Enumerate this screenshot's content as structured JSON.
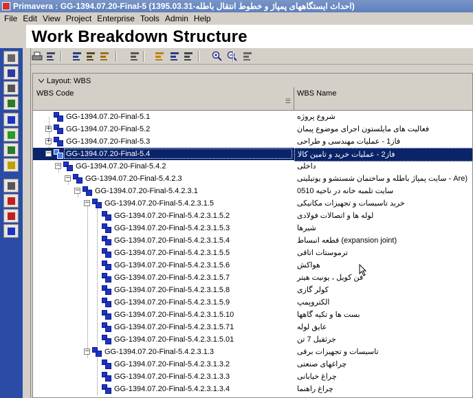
{
  "window": {
    "title": "Primavera : GG-1394.07.20-Final-5 (1395.03.31-احداث ایستگاههای پمپاژ و خطوط انتقال باطله)"
  },
  "menu": [
    "File",
    "Edit",
    "View",
    "Project",
    "Enterprise",
    "Tools",
    "Admin",
    "Help"
  ],
  "page": {
    "title": "Work Breakdown Structure"
  },
  "layout": {
    "label": "Layout: WBS"
  },
  "columns": {
    "code": "WBS Code",
    "name": "WBS Name"
  },
  "colors": {
    "selection": "#0a246a",
    "node": "#1c34c4",
    "left_toolbar": "#2a4ca6"
  },
  "toolbar_icons": [
    "print-icon",
    "print-preview-icon",
    "link-icon",
    "layout-icon",
    "group-icon",
    "filter-icon",
    "columns-icon",
    "bars-icon",
    "table-icon",
    "zoom-in-icon",
    "zoom-out-icon",
    "settings-icon"
  ],
  "left_toolbar_icons": [
    "projects-icon",
    "resources-icon",
    "reports-icon",
    "tracking-icon",
    "wbs-icon",
    "activities-icon",
    "assignments-icon",
    "documents-icon",
    "expenses-icon",
    "issues-icon",
    "risks-icon",
    "next-icon"
  ],
  "rows": [
    {
      "code": "GG-1394.07.20-Final-5.1",
      "name": "شروع پروژه",
      "level": 1,
      "expander": "",
      "selected": false
    },
    {
      "code": "GG-1394.07.20-Final-5.2",
      "name": "فعالیت های مایلستون اجرای موضوع پیمان",
      "level": 1,
      "expander": "+",
      "selected": false
    },
    {
      "code": "GG-1394.07.20-Final-5.3",
      "name": "فاز1 - عملیات مهندسی و طراحی",
      "level": 1,
      "expander": "+",
      "selected": false
    },
    {
      "code": "GG-1394.07.20-Final-5.4",
      "name": "فاز2 - عملیات خرید و تامین کالا",
      "level": 1,
      "expander": "-",
      "selected": true
    },
    {
      "code": "GG-1394.07.20-Final-5.4.2",
      "name": "داخلی",
      "level": 2,
      "expander": "-",
      "selected": false
    },
    {
      "code": "GG-1394.07.20-Final-5.4.2.3",
      "name": "(Are - سایت پمپاژ باطله و ساختمان شستشو و یوتیلیتی",
      "level": 3,
      "expander": "-",
      "selected": false
    },
    {
      "code": "GG-1394.07.20-Final-5.4.2.3.1",
      "name": "سایت تلمبه خانه در ناحیه 0510",
      "level": 4,
      "expander": "-",
      "selected": false
    },
    {
      "code": "GG-1394.07.20-Final-5.4.2.3.1.5",
      "name": "خرید تاسیسات و تجهیزات مکانیکی",
      "level": 5,
      "expander": "-",
      "selected": false
    },
    {
      "code": "GG-1394.07.20-Final-5.4.2.3.1.5.2",
      "name": "لوله ها و اتصالات فولادی",
      "level": 6,
      "expander": "",
      "selected": false
    },
    {
      "code": "GG-1394.07.20-Final-5.4.2.3.1.5.3",
      "name": "شیرها",
      "level": 6,
      "expander": "",
      "selected": false
    },
    {
      "code": "GG-1394.07.20-Final-5.4.2.3.1.5.4",
      "name": "(expansion joint) قطعه انبساط",
      "level": 6,
      "expander": "",
      "selected": false
    },
    {
      "code": "GG-1394.07.20-Final-5.4.2.3.1.5.5",
      "name": "ترموستات اتاقی",
      "level": 6,
      "expander": "",
      "selected": false
    },
    {
      "code": "GG-1394.07.20-Final-5.4.2.3.1.5.6",
      "name": "هواکش",
      "level": 6,
      "expander": "",
      "selected": false
    },
    {
      "code": "GG-1394.07.20-Final-5.4.2.3.1.5.7",
      "name": "فن کویل ، یونیت هیتر",
      "level": 6,
      "expander": "",
      "selected": false
    },
    {
      "code": "GG-1394.07.20-Final-5.4.2.3.1.5.8",
      "name": "کولر گازی",
      "level": 6,
      "expander": "",
      "selected": false
    },
    {
      "code": "GG-1394.07.20-Final-5.4.2.3.1.5.9",
      "name": "الکتروپمپ",
      "level": 6,
      "expander": "",
      "selected": false
    },
    {
      "code": "GG-1394.07.20-Final-5.4.2.3.1.5.10",
      "name": "بست ها و تکیه گاهها",
      "level": 6,
      "expander": "",
      "selected": false
    },
    {
      "code": "GG-1394.07.20-Final-5.4.2.3.1.5.71",
      "name": "عایق لوله",
      "level": 6,
      "expander": "",
      "selected": false
    },
    {
      "code": "GG-1394.07.20-Final-5.4.2.3.1.5.01",
      "name": "جرثقیل 7 تن",
      "level": 6,
      "expander": "",
      "selected": false
    },
    {
      "code": "GG-1394.07.20-Final-5.4.2.3.1.3",
      "name": "تاسیسات و تجهیزات برقی",
      "level": 5,
      "expander": "-",
      "selected": false
    },
    {
      "code": "GG-1394.07.20-Final-5.4.2.3.1.3.2",
      "name": "چراغهای صنعتی",
      "level": 6,
      "expander": "",
      "selected": false
    },
    {
      "code": "GG-1394.07.20-Final-5.4.2.3.1.3.3",
      "name": "چراغ خیابانی",
      "level": 6,
      "expander": "",
      "selected": false
    },
    {
      "code": "GG-1394.07.20-Final-5.4.2.3.1.3.4",
      "name": "چراغ راهنما",
      "level": 6,
      "expander": "",
      "selected": false
    }
  ]
}
